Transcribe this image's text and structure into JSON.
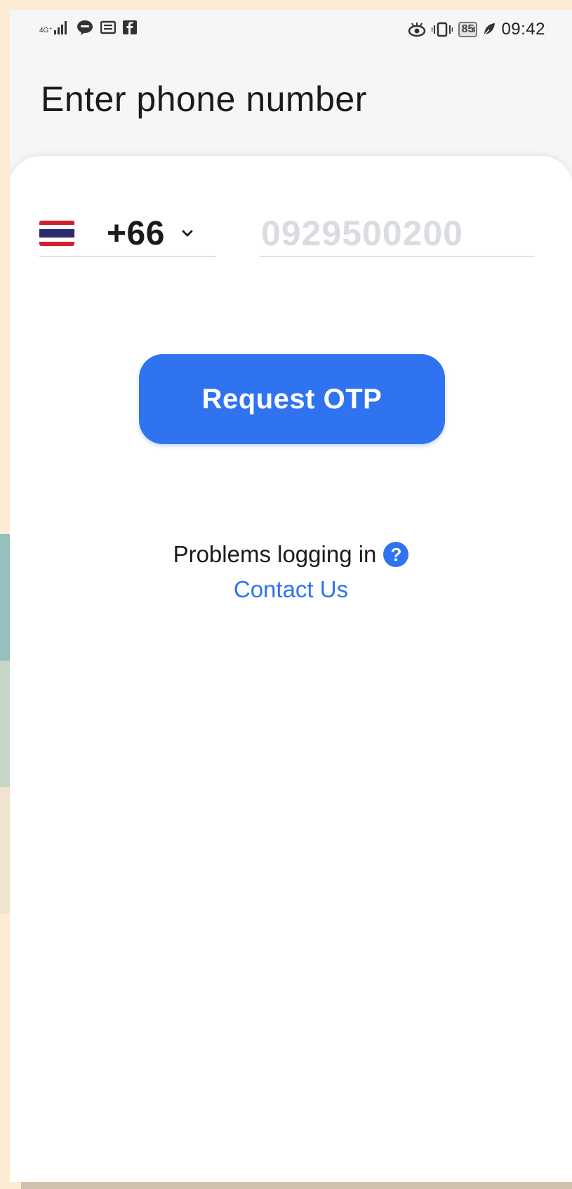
{
  "status_bar": {
    "network_label": "4G⁺",
    "battery_level": "85",
    "time": "09:42",
    "icons_left": [
      "signal-icon",
      "line-chat-icon",
      "message-icon",
      "facebook-icon"
    ],
    "icons_right": [
      "eye-comfort-icon",
      "vibrate-icon",
      "battery-icon",
      "leaf-icon"
    ]
  },
  "page": {
    "title": "Enter phone number"
  },
  "phone_form": {
    "country_code": "+66",
    "country_flag": "thailand-flag",
    "phone_placeholder": "0929500200",
    "phone_value": ""
  },
  "actions": {
    "request_otp_label": "Request OTP"
  },
  "help": {
    "problem_text": "Problems logging in",
    "help_icon_glyph": "?",
    "contact_label": "Contact Us"
  },
  "colors": {
    "accent": "#2F73F1",
    "background": "#F6F6F6",
    "sheet": "#FFFFFF",
    "placeholder": "#D9DCE1"
  }
}
